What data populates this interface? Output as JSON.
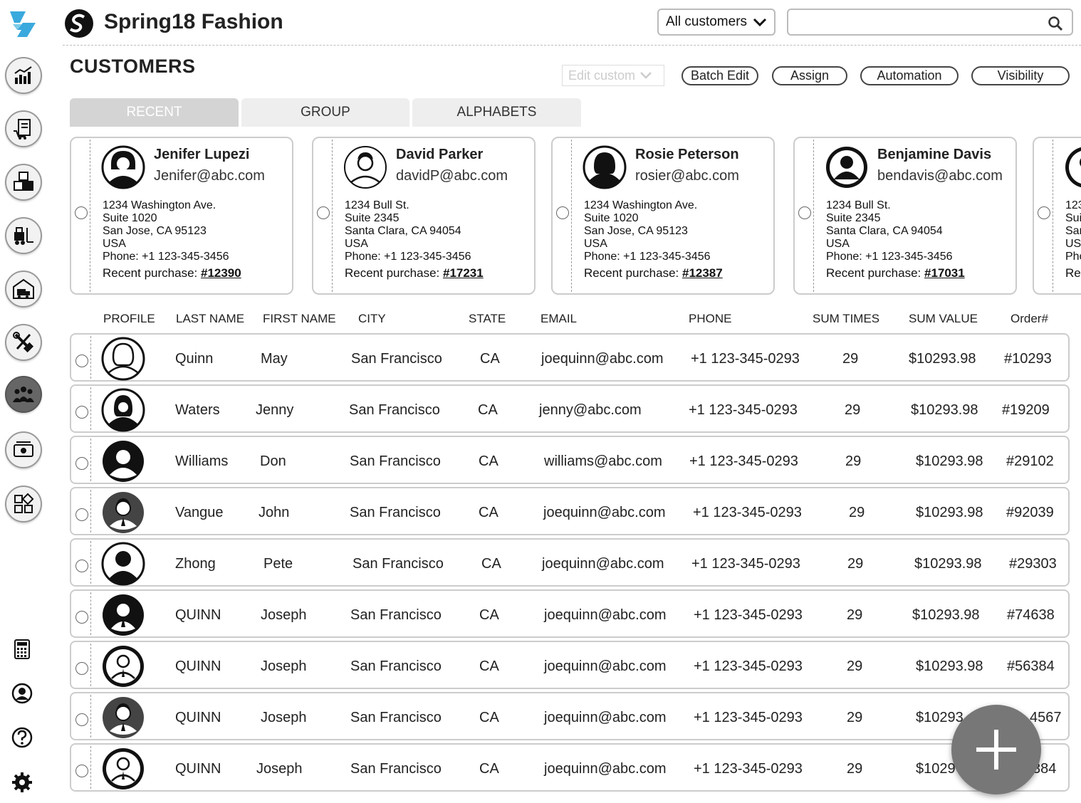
{
  "header": {
    "brand": "Spring18 Fashion",
    "customer_filter": "All customers",
    "search_value": ""
  },
  "page": {
    "title": "CUSTOMERS"
  },
  "toolbar": {
    "edit_custom": "Edit custom",
    "batch_edit": "Batch Edit",
    "assign": "Assign",
    "automation": "Automation",
    "visibility": "Visibility"
  },
  "tabs": [
    {
      "label": "RECENT",
      "active": true
    },
    {
      "label": "GROUP",
      "active": false
    },
    {
      "label": "ALPHABETS",
      "active": false
    }
  ],
  "recent_label": "Recent purchase:",
  "cards": [
    {
      "name": "Jenifer Lupezi",
      "email": "Jenifer@abc.com",
      "street": "1234 Washington Ave.",
      "suite": "Suite 1020",
      "city_line": "San Jose, CA 95123",
      "country": "USA",
      "phone": "Phone: +1 123-345-3456",
      "purchase": "#12390"
    },
    {
      "name": "David Parker",
      "email": "davidP@abc.com",
      "street": "1234 Bull St.",
      "suite": "Suite 2345",
      "city_line": "Santa Clara, CA 94054",
      "country": "USA",
      "phone": "Phone: +1 123-345-3456",
      "purchase": "#17231"
    },
    {
      "name": "Rosie Peterson",
      "email": "rosier@abc.com",
      "street": "1234 Washington Ave.",
      "suite": "Suite 1020",
      "city_line": "San Jose, CA 95123",
      "country": "USA",
      "phone": "Phone: +1 123-345-3456",
      "purchase": "#12387"
    },
    {
      "name": "Benjamine Davis",
      "email": "bendavis@abc.com",
      "street": "1234 Bull St.",
      "suite": "Suite 2345",
      "city_line": "Santa Clara, CA 94054",
      "country": "USA",
      "phone": "Phone: +1 123-345-3456",
      "purchase": "#17031"
    },
    {
      "name": "",
      "email": "",
      "street": "123",
      "suite": "Suit",
      "city_line": "San",
      "country": "USA",
      "phone": "Pho",
      "purchase": "",
      "recent_partial": "Rec"
    }
  ],
  "table": {
    "headers": [
      "PROFILE",
      "LAST NAME",
      "FIRST NAME",
      "CITY",
      "STATE",
      "EMAIL",
      "PHONE",
      "SUM TIMES",
      "SUM VALUE",
      "Order#"
    ],
    "rows": [
      {
        "last": "Quinn",
        "first": "May",
        "city": "San Francisco",
        "state": "CA",
        "email": "joequinn@abc.com",
        "phone": "+1 123-345-0293",
        "times": "29",
        "value": "$10293.98",
        "order": "#10293"
      },
      {
        "last": "Waters",
        "first": "Jenny",
        "city": "San Francisco",
        "state": "CA",
        "email": "jenny@abc.com",
        "phone": "+1 123-345-0293",
        "times": "29",
        "value": "$10293.98",
        "order": "#19209"
      },
      {
        "last": "Williams",
        "first": "Don",
        "city": "San Francisco",
        "state": "CA",
        "email": "williams@abc.com",
        "phone": "+1 123-345-0293",
        "times": "29",
        "value": "$10293.98",
        "order": "#29102"
      },
      {
        "last": "Vangue",
        "first": "John",
        "city": "San Francisco",
        "state": "CA",
        "email": "joequinn@abc.com",
        "phone": "+1 123-345-0293",
        "times": "29",
        "value": "$10293.98",
        "order": "#92039"
      },
      {
        "last": "Zhong",
        "first": "Pete",
        "city": "San Francisco",
        "state": "CA",
        "email": "joequinn@abc.com",
        "phone": "+1 123-345-0293",
        "times": "29",
        "value": "$10293.98",
        "order": "#29303"
      },
      {
        "last": "QUINN",
        "first": "Joseph",
        "city": "San Francisco",
        "state": "CA",
        "email": "joequinn@abc.com",
        "phone": "+1 123-345-0293",
        "times": "29",
        "value": "$10293.98",
        "order": "#74638"
      },
      {
        "last": "QUINN",
        "first": "Joseph",
        "city": "San Francisco",
        "state": "CA",
        "email": "joequinn@abc.com",
        "phone": "+1 123-345-0293",
        "times": "29",
        "value": "$10293.98",
        "order": "#56384"
      },
      {
        "last": "QUINN",
        "first": "Joseph",
        "city": "San Francisco",
        "state": "CA",
        "email": "joequinn@abc.com",
        "phone": "+1 123-345-0293",
        "times": "29",
        "value": "$10293",
        "order": "4567"
      },
      {
        "last": "QUINN",
        "first": "Joseph",
        "city": "San Francisco",
        "state": "CA",
        "email": "joequinn@abc.com",
        "phone": "+1 123-345-0293",
        "times": "29",
        "value": "$1029",
        "order": "384"
      }
    ]
  },
  "sidebar": {
    "nav": [
      "analytics-icon",
      "orders-icon",
      "inventory-icon",
      "warehouse-forklift-icon",
      "shipping-icon",
      "tools-icon",
      "customers-icon",
      "payments-icon",
      "apps-icon"
    ],
    "utilities": [
      "calculator-icon",
      "user-account-icon",
      "help-icon",
      "settings-icon"
    ]
  },
  "colors": {
    "logo_blue": "#3aa9dd",
    "active_nav": "#666666",
    "fab": "#777777",
    "border": "#cccccc"
  }
}
